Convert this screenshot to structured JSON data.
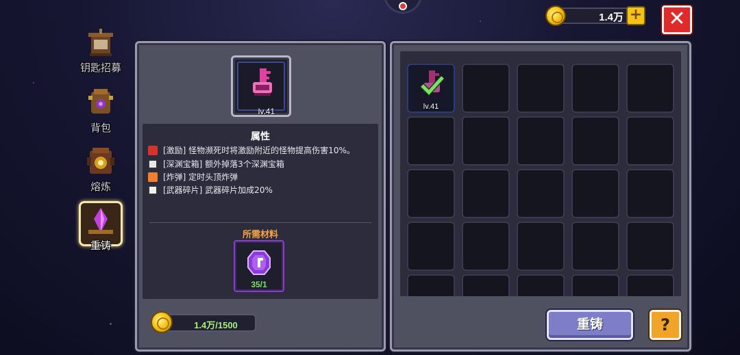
{
  "currency": {
    "amount": "1.4万",
    "plus": "+"
  },
  "close": "✕",
  "sidebar": {
    "items": [
      {
        "label": "钥匙招募"
      },
      {
        "label": "背包"
      },
      {
        "label": "熔炼"
      },
      {
        "label": "重铸",
        "active": true
      }
    ]
  },
  "item": {
    "level": "lv.41"
  },
  "attributes": {
    "title": "属性",
    "lines": [
      {
        "text": "[激励] 怪物濒死时将激励附近的怪物提高伤害10%。",
        "icon": "monster-face-icon",
        "color": "#d8322c"
      },
      {
        "text": "[深渊宝箱] 额外掉落3个深渊宝箱",
        "icon": "chest-icon",
        "color": "#e8e8e8"
      },
      {
        "text": "[炸弹] 定时头顶炸弹",
        "icon": "bomb-fire-icon",
        "color": "#f08030"
      },
      {
        "text": "[武器碎片] 武器碎片加成20%",
        "icon": "fragment-icon",
        "color": "#f0f0f0"
      }
    ]
  },
  "material": {
    "title": "所需材料",
    "count": "35/1",
    "icon": "purple-gem-icon"
  },
  "cost": "1.4万/1500",
  "inventory": {
    "first_item_level": "lv.41"
  },
  "reforge_button": "重铸",
  "help_button": "?"
}
